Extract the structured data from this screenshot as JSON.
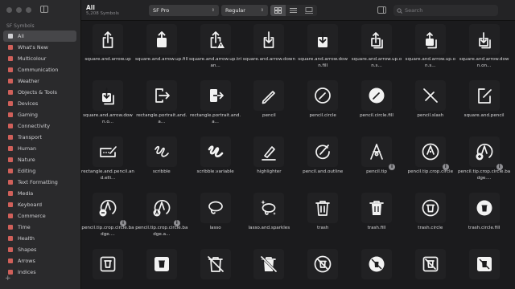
{
  "sidebar": {
    "header": "SF Symbols",
    "items": [
      {
        "label": "All",
        "selected": true
      },
      {
        "label": "What's New"
      },
      {
        "label": "Multicolour"
      },
      {
        "label": "Communication"
      },
      {
        "label": "Weather"
      },
      {
        "label": "Objects & Tools"
      },
      {
        "label": "Devices"
      },
      {
        "label": "Gaming"
      },
      {
        "label": "Connectivity"
      },
      {
        "label": "Transport"
      },
      {
        "label": "Human"
      },
      {
        "label": "Nature"
      },
      {
        "label": "Editing"
      },
      {
        "label": "Text Formatting"
      },
      {
        "label": "Media"
      },
      {
        "label": "Keyboard"
      },
      {
        "label": "Commerce"
      },
      {
        "label": "Time"
      },
      {
        "label": "Health"
      },
      {
        "label": "Shapes"
      },
      {
        "label": "Arrows"
      },
      {
        "label": "Indices"
      }
    ],
    "add_label": "+"
  },
  "toolbar": {
    "title": "All",
    "subtitle": "5,208 Symbols",
    "font_select": "SF Pro",
    "weight_select": "Regular",
    "search_placeholder": "Search"
  },
  "colors": {
    "accent_icon": "#d0605a",
    "background": "#1b1b1d",
    "sidebar": "#2a2a2c"
  },
  "symbols": [
    {
      "name": "square.and.arrow.up",
      "icon": "share"
    },
    {
      "name": "square.and.arrow.up.fill",
      "icon": "share-fill"
    },
    {
      "name": "square.and.arrow.up.trian...",
      "icon": "share-warn"
    },
    {
      "name": "square.and.arrow.down",
      "icon": "down"
    },
    {
      "name": "square.and.arrow.down.fill",
      "icon": "down-fill"
    },
    {
      "name": "square.and.arrow.up.on.s...",
      "icon": "share-stack"
    },
    {
      "name": "square.and.arrow.up.on.s...",
      "icon": "share-stack-fill"
    },
    {
      "name": "square.and.arrow.down.on...",
      "icon": "down-stack"
    },
    {
      "name": "square.and.arrow.down.o...",
      "icon": "down-stack-fill"
    },
    {
      "name": "rectangle.portrait.and.a...",
      "icon": "portrait-arrow"
    },
    {
      "name": "rectangle.portrait.and.a...",
      "icon": "portrait-arrow-fill"
    },
    {
      "name": "pencil",
      "icon": "pencil"
    },
    {
      "name": "pencil.circle",
      "icon": "pencil-circle"
    },
    {
      "name": "pencil.circle.fill",
      "icon": "pencil-circle-fill"
    },
    {
      "name": "pencil.slash",
      "icon": "pencil-slash"
    },
    {
      "name": "square.and.pencil",
      "icon": "square-pencil"
    },
    {
      "name": "rectangle.and.pencil.and.elli...",
      "icon": "rect-pencil"
    },
    {
      "name": "scribble",
      "icon": "scribble"
    },
    {
      "name": "scribble.variable",
      "icon": "scribble-var"
    },
    {
      "name": "highlighter",
      "icon": "highlighter"
    },
    {
      "name": "pencil.and.outline",
      "icon": "pencil-outline"
    },
    {
      "name": "pencil.tip",
      "icon": "pencil-tip",
      "info": true
    },
    {
      "name": "pencil.tip.crop.circle",
      "icon": "tip-circle",
      "info": true
    },
    {
      "name": "pencil.tip.crop.circle.badge....",
      "icon": "tip-badge-plus",
      "info": true
    },
    {
      "name": "pencil.tip.crop.circle.badge....",
      "icon": "tip-badge-minus",
      "info": true
    },
    {
      "name": "pencil.tip.crop.circle.badge.a...",
      "icon": "tip-badge-a",
      "info": true
    },
    {
      "name": "lasso",
      "icon": "lasso"
    },
    {
      "name": "lasso.and.sparkles",
      "icon": "lasso-sparkles"
    },
    {
      "name": "trash",
      "icon": "trash"
    },
    {
      "name": "trash.fill",
      "icon": "trash-fill"
    },
    {
      "name": "trash.circle",
      "icon": "trash-circle"
    },
    {
      "name": "trash.circle.fill",
      "icon": "trash-circle-fill"
    },
    {
      "name": "",
      "icon": "trash-square"
    },
    {
      "name": "",
      "icon": "trash-square-fill"
    },
    {
      "name": "",
      "icon": "trash-slash"
    },
    {
      "name": "",
      "icon": "trash-slash-fill"
    },
    {
      "name": "",
      "icon": "trash-slash-circle"
    },
    {
      "name": "",
      "icon": "trash-slash-circle-fill"
    },
    {
      "name": "",
      "icon": "trash-slash-square"
    },
    {
      "name": "",
      "icon": "trash-slash-square-fill"
    }
  ]
}
